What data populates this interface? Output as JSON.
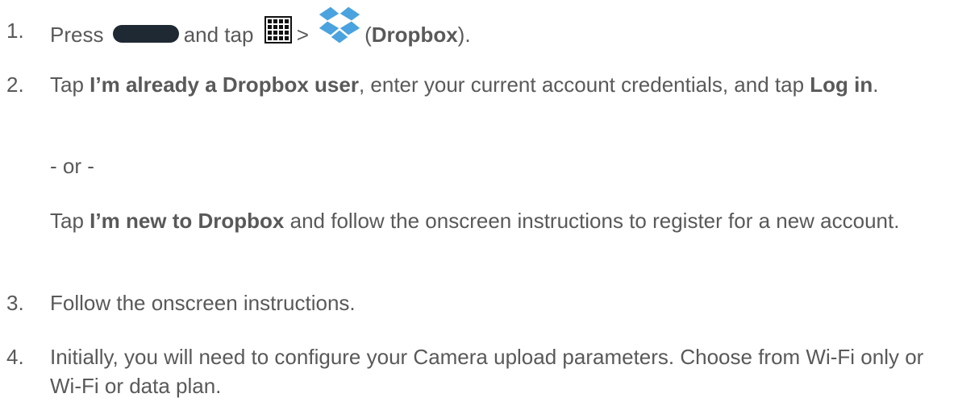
{
  "steps": {
    "s1": {
      "num": "1.",
      "t1": "Press",
      "t2": "and tap",
      "t3": ">",
      "t4": "(",
      "b1": "Dropbox",
      "t5": ")."
    },
    "s2": {
      "num": "2.",
      "t1": "Tap ",
      "b1": "I’m already a Dropbox user",
      "t2": ", enter your current account credentials, and tap ",
      "b2": "Log in",
      "t3": "."
    },
    "or": "- or -",
    "alt": {
      "t1": "Tap ",
      "b1": "I’m new to Dropbox",
      "t2": " and follow the onscreen instructions to register for a new account."
    },
    "s3": {
      "num": "3.",
      "text": "Follow the onscreen instructions."
    },
    "s4": {
      "num": "4.",
      "text": "Initially, you will need to configure your Camera upload parameters. Choose from Wi-Fi only or Wi-Fi or data plan."
    }
  },
  "icons": {
    "home_key": "home-key-icon",
    "apps": "apps-grid-icon",
    "dropbox": "dropbox-icon"
  },
  "colors": {
    "text": "#595959",
    "dropbox_blue": "#4aa3df"
  }
}
